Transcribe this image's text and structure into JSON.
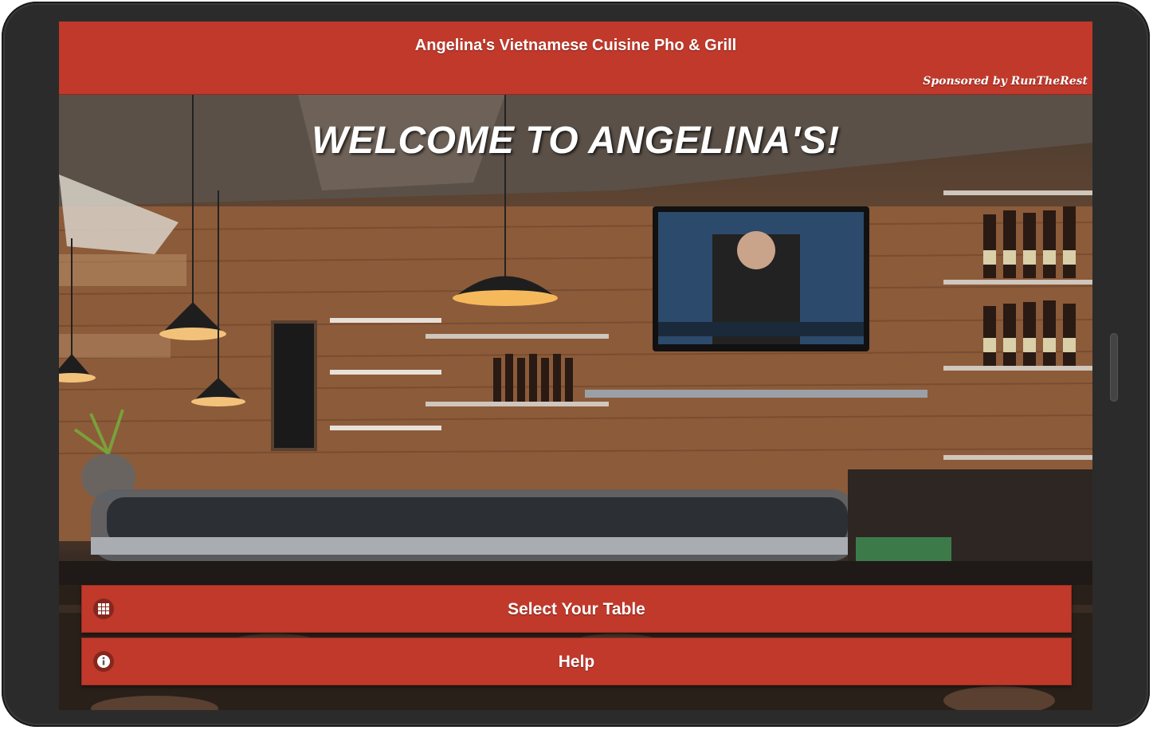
{
  "header": {
    "title": "Angelina's Vietnamese Cuisine Pho & Grill",
    "sponsor": "Sponsored by RunTheRest"
  },
  "hero": {
    "welcome": "WELCOME TO ANGELINA'S!"
  },
  "actions": [
    {
      "label": "Select Your Table",
      "icon": "grid-icon"
    },
    {
      "label": "Help",
      "icon": "info-icon"
    }
  ],
  "colors": {
    "accent": "#c0392b",
    "device_frame": "#2b2b2b",
    "text": "#ffffff"
  }
}
